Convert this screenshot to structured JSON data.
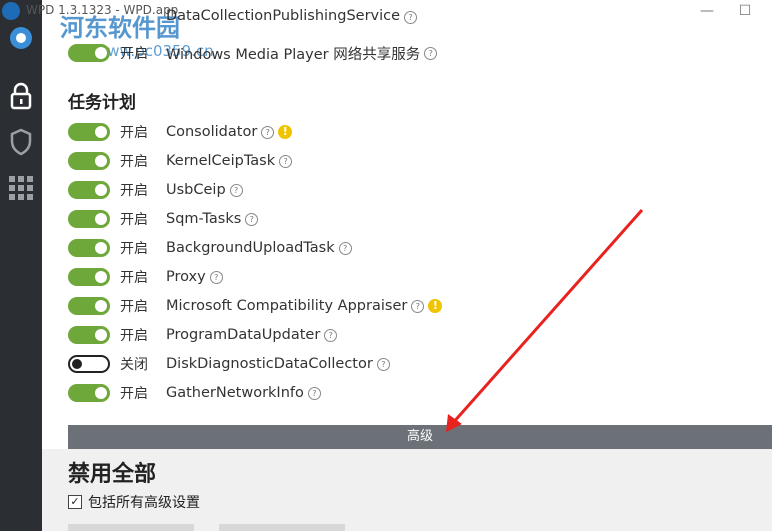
{
  "window": {
    "title": "WPD 1.3.1323 - WPD.app",
    "minimize": "—",
    "maximize": "☐"
  },
  "watermark": {
    "site": "河东软件园",
    "url": "www.pc0359.cn"
  },
  "sidebar": {
    "icons": [
      "logo-icon",
      "lock-icon",
      "shield-icon",
      "grid-icon"
    ]
  },
  "top_rows": [
    {
      "state": "开启",
      "name": "DataCollectionPublishingService",
      "on": true
    },
    {
      "state": "开启",
      "name": "Windows Media Player 网络共享服务",
      "on": true
    }
  ],
  "section": {
    "title": "任务计划"
  },
  "tasks": [
    {
      "state": "开启",
      "name": "Consolidator",
      "on": true,
      "warn": true
    },
    {
      "state": "开启",
      "name": "KernelCeipTask",
      "on": true,
      "warn": false
    },
    {
      "state": "开启",
      "name": "UsbCeip",
      "on": true,
      "warn": false
    },
    {
      "state": "开启",
      "name": "Sqm-Tasks",
      "on": true,
      "warn": false
    },
    {
      "state": "开启",
      "name": "BackgroundUploadTask",
      "on": true,
      "warn": false
    },
    {
      "state": "开启",
      "name": "Proxy",
      "on": true,
      "warn": false
    },
    {
      "state": "开启",
      "name": "Microsoft Compatibility Appraiser",
      "on": true,
      "warn": true
    },
    {
      "state": "开启",
      "name": "ProgramDataUpdater",
      "on": true,
      "warn": false
    },
    {
      "state": "关闭",
      "name": "DiskDiagnosticDataCollector",
      "on": false,
      "warn": false
    },
    {
      "state": "开启",
      "name": "GatherNetworkInfo",
      "on": true,
      "warn": false
    }
  ],
  "advanced": {
    "label": "高级"
  },
  "disable": {
    "title": "禁用全部",
    "checkbox_label": "包括所有高级设置",
    "checked": true
  },
  "help_glyph": "?",
  "warn_glyph": "!",
  "colors": {
    "toggle_on": "#6fa83a",
    "sidebar": "#2b2f33",
    "advanced_bar": "#6b7177",
    "arrow": "#e8231f"
  }
}
